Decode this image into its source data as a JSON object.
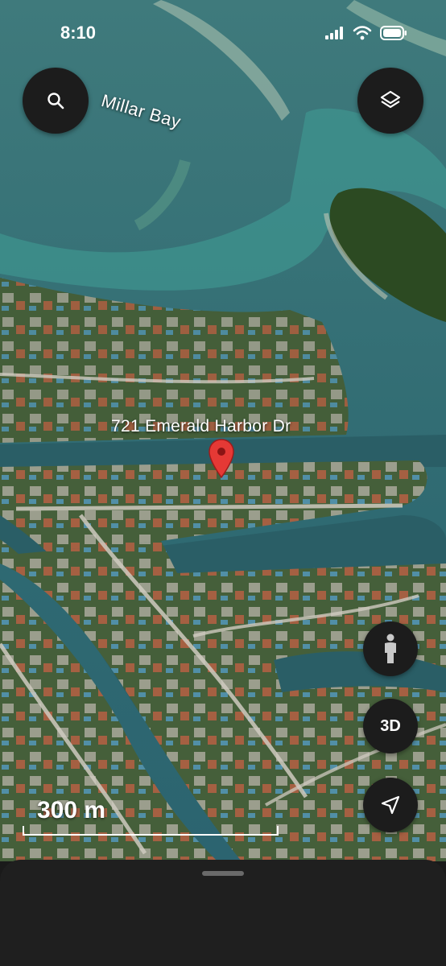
{
  "status_bar": {
    "time": "8:10"
  },
  "map": {
    "bay_label": "Millar Bay",
    "address_label": "721 Emerald Harbor Dr",
    "scale_label": "300 m"
  },
  "controls": {
    "search_icon": "search-icon",
    "layers_icon": "layers-icon",
    "street_view_icon": "person-icon",
    "three_d_label": "3D",
    "location_icon": "navigation-arrow-icon"
  },
  "colors": {
    "water_deep": "#2f6a72",
    "water_shallow": "#4a9a92",
    "land": "#3f5a33",
    "pin": "#e53935",
    "button_bg": "#1c1c1c"
  }
}
